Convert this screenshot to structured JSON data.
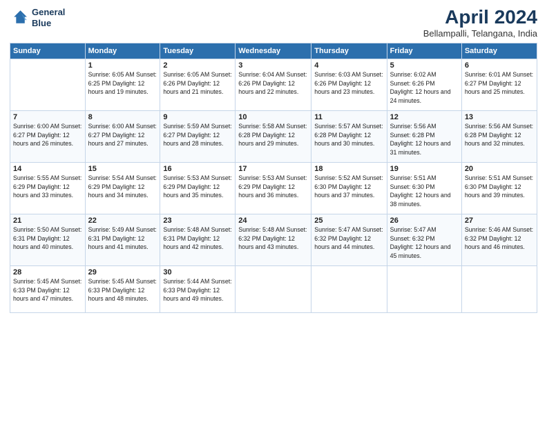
{
  "logo": {
    "line1": "General",
    "line2": "Blue"
  },
  "title": "April 2024",
  "subtitle": "Bellampalli, Telangana, India",
  "days_of_week": [
    "Sunday",
    "Monday",
    "Tuesday",
    "Wednesday",
    "Thursday",
    "Friday",
    "Saturday"
  ],
  "weeks": [
    [
      {
        "day": "",
        "info": ""
      },
      {
        "day": "1",
        "info": "Sunrise: 6:05 AM\nSunset: 6:25 PM\nDaylight: 12 hours\nand 19 minutes."
      },
      {
        "day": "2",
        "info": "Sunrise: 6:05 AM\nSunset: 6:26 PM\nDaylight: 12 hours\nand 21 minutes."
      },
      {
        "day": "3",
        "info": "Sunrise: 6:04 AM\nSunset: 6:26 PM\nDaylight: 12 hours\nand 22 minutes."
      },
      {
        "day": "4",
        "info": "Sunrise: 6:03 AM\nSunset: 6:26 PM\nDaylight: 12 hours\nand 23 minutes."
      },
      {
        "day": "5",
        "info": "Sunrise: 6:02 AM\nSunset: 6:26 PM\nDaylight: 12 hours\nand 24 minutes."
      },
      {
        "day": "6",
        "info": "Sunrise: 6:01 AM\nSunset: 6:27 PM\nDaylight: 12 hours\nand 25 minutes."
      }
    ],
    [
      {
        "day": "7",
        "info": "Sunrise: 6:00 AM\nSunset: 6:27 PM\nDaylight: 12 hours\nand 26 minutes."
      },
      {
        "day": "8",
        "info": "Sunrise: 6:00 AM\nSunset: 6:27 PM\nDaylight: 12 hours\nand 27 minutes."
      },
      {
        "day": "9",
        "info": "Sunrise: 5:59 AM\nSunset: 6:27 PM\nDaylight: 12 hours\nand 28 minutes."
      },
      {
        "day": "10",
        "info": "Sunrise: 5:58 AM\nSunset: 6:28 PM\nDaylight: 12 hours\nand 29 minutes."
      },
      {
        "day": "11",
        "info": "Sunrise: 5:57 AM\nSunset: 6:28 PM\nDaylight: 12 hours\nand 30 minutes."
      },
      {
        "day": "12",
        "info": "Sunrise: 5:56 AM\nSunset: 6:28 PM\nDaylight: 12 hours\nand 31 minutes."
      },
      {
        "day": "13",
        "info": "Sunrise: 5:56 AM\nSunset: 6:28 PM\nDaylight: 12 hours\nand 32 minutes."
      }
    ],
    [
      {
        "day": "14",
        "info": "Sunrise: 5:55 AM\nSunset: 6:29 PM\nDaylight: 12 hours\nand 33 minutes."
      },
      {
        "day": "15",
        "info": "Sunrise: 5:54 AM\nSunset: 6:29 PM\nDaylight: 12 hours\nand 34 minutes."
      },
      {
        "day": "16",
        "info": "Sunrise: 5:53 AM\nSunset: 6:29 PM\nDaylight: 12 hours\nand 35 minutes."
      },
      {
        "day": "17",
        "info": "Sunrise: 5:53 AM\nSunset: 6:29 PM\nDaylight: 12 hours\nand 36 minutes."
      },
      {
        "day": "18",
        "info": "Sunrise: 5:52 AM\nSunset: 6:30 PM\nDaylight: 12 hours\nand 37 minutes."
      },
      {
        "day": "19",
        "info": "Sunrise: 5:51 AM\nSunset: 6:30 PM\nDaylight: 12 hours\nand 38 minutes."
      },
      {
        "day": "20",
        "info": "Sunrise: 5:51 AM\nSunset: 6:30 PM\nDaylight: 12 hours\nand 39 minutes."
      }
    ],
    [
      {
        "day": "21",
        "info": "Sunrise: 5:50 AM\nSunset: 6:31 PM\nDaylight: 12 hours\nand 40 minutes."
      },
      {
        "day": "22",
        "info": "Sunrise: 5:49 AM\nSunset: 6:31 PM\nDaylight: 12 hours\nand 41 minutes."
      },
      {
        "day": "23",
        "info": "Sunrise: 5:48 AM\nSunset: 6:31 PM\nDaylight: 12 hours\nand 42 minutes."
      },
      {
        "day": "24",
        "info": "Sunrise: 5:48 AM\nSunset: 6:32 PM\nDaylight: 12 hours\nand 43 minutes."
      },
      {
        "day": "25",
        "info": "Sunrise: 5:47 AM\nSunset: 6:32 PM\nDaylight: 12 hours\nand 44 minutes."
      },
      {
        "day": "26",
        "info": "Sunrise: 5:47 AM\nSunset: 6:32 PM\nDaylight: 12 hours\nand 45 minutes."
      },
      {
        "day": "27",
        "info": "Sunrise: 5:46 AM\nSunset: 6:32 PM\nDaylight: 12 hours\nand 46 minutes."
      }
    ],
    [
      {
        "day": "28",
        "info": "Sunrise: 5:45 AM\nSunset: 6:33 PM\nDaylight: 12 hours\nand 47 minutes."
      },
      {
        "day": "29",
        "info": "Sunrise: 5:45 AM\nSunset: 6:33 PM\nDaylight: 12 hours\nand 48 minutes."
      },
      {
        "day": "30",
        "info": "Sunrise: 5:44 AM\nSunset: 6:33 PM\nDaylight: 12 hours\nand 49 minutes."
      },
      {
        "day": "",
        "info": ""
      },
      {
        "day": "",
        "info": ""
      },
      {
        "day": "",
        "info": ""
      },
      {
        "day": "",
        "info": ""
      }
    ]
  ]
}
